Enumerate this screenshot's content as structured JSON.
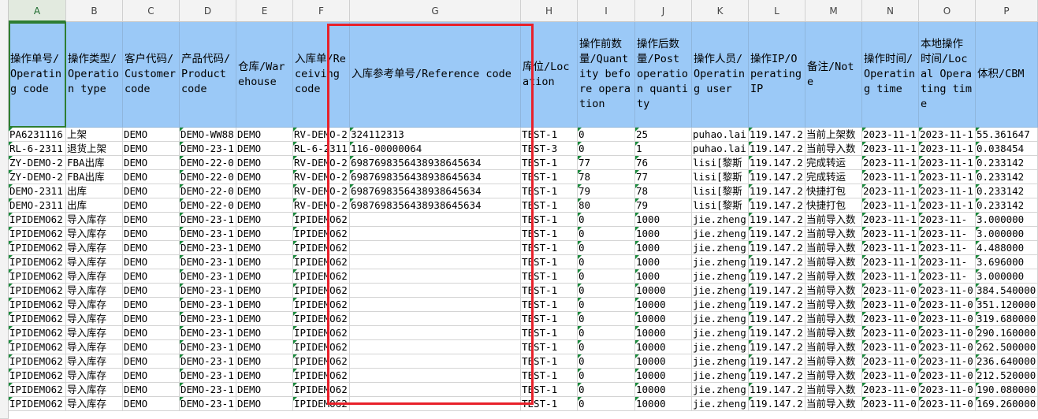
{
  "columns": [
    {
      "letter": "A",
      "header": "操作单号/Operating code"
    },
    {
      "letter": "B",
      "header": "操作类型/Operation type"
    },
    {
      "letter": "C",
      "header": "客户代码/Customer code"
    },
    {
      "letter": "D",
      "header": "产品代码/Product code"
    },
    {
      "letter": "E",
      "header": "仓库/Warehouse"
    },
    {
      "letter": "F",
      "header": "入库单/Receiving code"
    },
    {
      "letter": "G",
      "header": "入库参考单号/Reference code"
    },
    {
      "letter": "H",
      "header": "库位/Location"
    },
    {
      "letter": "I",
      "header": "操作前数量/Quantity before operation"
    },
    {
      "letter": "J",
      "header": "操作后数量/Post operation quantity"
    },
    {
      "letter": "K",
      "header": "操作人员/Operating user"
    },
    {
      "letter": "L",
      "header": "操作IP/Operating IP"
    },
    {
      "letter": "M",
      "header": "备注/Note"
    },
    {
      "letter": "N",
      "header": "操作时间/Operating time"
    },
    {
      "letter": "O",
      "header": "本地操作时间/Local Operating time"
    },
    {
      "letter": "P",
      "header": "体积/CBM"
    }
  ],
  "rows": [
    [
      "PA6231116",
      "上架",
      "DEMO",
      "DEMO-WW88",
      "DEMO",
      "RV-DEMO-2",
      "324112313",
      "TEST-1",
      "0",
      "25",
      "puhao.lai",
      "119.147.2",
      "当前上架数",
      "2023-11-1",
      "2023-11-1",
      "55.361647"
    ],
    [
      "RL-6-2311",
      "退货上架",
      "DEMO",
      "DEMO-23-1",
      "DEMO",
      "RL-6-2311",
      "116-00000064",
      "TEST-3",
      "0",
      "1",
      "puhao.lai",
      "119.147.2",
      "当前导入数",
      "2023-11-1",
      "2023-11-1",
      "0.038454"
    ],
    [
      "ZY-DEMO-2",
      "FBA出库",
      "DEMO",
      "DEMO-22-0",
      "DEMO",
      "RV-DEMO-2",
      "6987698356438938645634",
      "TEST-1",
      "77",
      "76",
      "lisi[黎斯",
      "119.147.2",
      "完成转运",
      "2023-11-1",
      "2023-11-1",
      "0.233142"
    ],
    [
      "ZY-DEMO-2",
      "FBA出库",
      "DEMO",
      "DEMO-22-0",
      "DEMO",
      "RV-DEMO-2",
      "6987698356438938645634",
      "TEST-1",
      "78",
      "77",
      "lisi[黎斯",
      "119.147.2",
      "完成转运",
      "2023-11-1",
      "2023-11-1",
      "0.233142"
    ],
    [
      "DEMO-2311",
      "出库",
      "DEMO",
      "DEMO-22-0",
      "DEMO",
      "RV-DEMO-2",
      "6987698356438938645634",
      "TEST-1",
      "79",
      "78",
      "lisi[黎斯",
      "119.147.2",
      "快捷打包",
      "2023-11-1",
      "2023-11-1",
      "0.233142"
    ],
    [
      "DEMO-2311",
      "出库",
      "DEMO",
      "DEMO-22-0",
      "DEMO",
      "RV-DEMO-2",
      "6987698356438938645634",
      "TEST-1",
      "80",
      "79",
      "lisi[黎斯",
      "119.147.2",
      "快捷打包",
      "2023-11-1",
      "2023-11-1",
      "0.233142"
    ],
    [
      "IPIDEMO62",
      "导入库存",
      "DEMO",
      "DEMO-23-1",
      "DEMO",
      "IPIDEMO62",
      "",
      "TEST-1",
      "0",
      "1000",
      "jie.zheng",
      "119.147.2",
      "当前导入数",
      "2023-11-1",
      "2023-11-",
      "3.000000"
    ],
    [
      "IPIDEMO62",
      "导入库存",
      "DEMO",
      "DEMO-23-1",
      "DEMO",
      "IPIDEMO62",
      "",
      "TEST-1",
      "0",
      "1000",
      "jie.zheng",
      "119.147.2",
      "当前导入数",
      "2023-11-1",
      "2023-11-",
      "3.000000"
    ],
    [
      "IPIDEMO62",
      "导入库存",
      "DEMO",
      "DEMO-23-1",
      "DEMO",
      "IPIDEMO62",
      "",
      "TEST-1",
      "0",
      "1000",
      "jie.zheng",
      "119.147.2",
      "当前导入数",
      "2023-11-1",
      "2023-11-",
      "4.488000"
    ],
    [
      "IPIDEMO62",
      "导入库存",
      "DEMO",
      "DEMO-23-1",
      "DEMO",
      "IPIDEMO62",
      "",
      "TEST-1",
      "0",
      "1000",
      "jie.zheng",
      "119.147.2",
      "当前导入数",
      "2023-11-1",
      "2023-11-",
      "3.696000"
    ],
    [
      "IPIDEMO62",
      "导入库存",
      "DEMO",
      "DEMO-23-1",
      "DEMO",
      "IPIDEMO62",
      "",
      "TEST-1",
      "0",
      "1000",
      "jie.zheng",
      "119.147.2",
      "当前导入数",
      "2023-11-1",
      "2023-11-",
      "3.000000"
    ],
    [
      "IPIDEMO62",
      "导入库存",
      "DEMO",
      "DEMO-23-1",
      "DEMO",
      "IPIDEMO62",
      "",
      "TEST-1",
      "0",
      "10000",
      "jie.zheng",
      "119.147.2",
      "当前导入数",
      "2023-11-0",
      "2023-11-0",
      "384.540000"
    ],
    [
      "IPIDEMO62",
      "导入库存",
      "DEMO",
      "DEMO-23-1",
      "DEMO",
      "IPIDEMO62",
      "",
      "TEST-1",
      "0",
      "10000",
      "jie.zheng",
      "119.147.2",
      "当前导入数",
      "2023-11-0",
      "2023-11-0",
      "351.120000"
    ],
    [
      "IPIDEMO62",
      "导入库存",
      "DEMO",
      "DEMO-23-1",
      "DEMO",
      "IPIDEMO62",
      "",
      "TEST-1",
      "0",
      "10000",
      "jie.zheng",
      "119.147.2",
      "当前导入数",
      "2023-11-0",
      "2023-11-0",
      "319.680000"
    ],
    [
      "IPIDEMO62",
      "导入库存",
      "DEMO",
      "DEMO-23-1",
      "DEMO",
      "IPIDEMO62",
      "",
      "TEST-1",
      "0",
      "10000",
      "jie.zheng",
      "119.147.2",
      "当前导入数",
      "2023-11-0",
      "2023-11-0",
      "290.160000"
    ],
    [
      "IPIDEMO62",
      "导入库存",
      "DEMO",
      "DEMO-23-1",
      "DEMO",
      "IPIDEMO62",
      "",
      "TEST-1",
      "0",
      "10000",
      "jie.zheng",
      "119.147.2",
      "当前导入数",
      "2023-11-0",
      "2023-11-0",
      "262.500000"
    ],
    [
      "IPIDEMO62",
      "导入库存",
      "DEMO",
      "DEMO-23-1",
      "DEMO",
      "IPIDEMO62",
      "",
      "TEST-1",
      "0",
      "10000",
      "jie.zheng",
      "119.147.2",
      "当前导入数",
      "2023-11-0",
      "2023-11-0",
      "236.640000"
    ],
    [
      "IPIDEMO62",
      "导入库存",
      "DEMO",
      "DEMO-23-1",
      "DEMO",
      "IPIDEMO62",
      "",
      "TEST-1",
      "0",
      "10000",
      "jie.zheng",
      "119.147.2",
      "当前导入数",
      "2023-11-0",
      "2023-11-0",
      "212.520000"
    ],
    [
      "IPIDEMO62",
      "导入库存",
      "DEMO",
      "DEMO-23-1",
      "DEMO",
      "IPIDEMO62",
      "",
      "TEST-1",
      "0",
      "10000",
      "jie.zheng",
      "119.147.2",
      "当前导入数",
      "2023-11-0",
      "2023-11-0",
      "190.080000"
    ],
    [
      "IPIDEMO62",
      "导入库存",
      "DEMO",
      "DEMO-23-1",
      "DEMO",
      "IPIDEMO62",
      "",
      "TEST-1",
      "0",
      "10000",
      "jie.zheng",
      "119.147.2",
      "当前导入数",
      "2023-11-0",
      "2023-11-0",
      "169.260000"
    ]
  ],
  "colors": {
    "header_fill": "#9bc9f7",
    "selection_border": "#2e7d32",
    "highlight_box": "#e8202a",
    "error_triangle": "#1a8a3c"
  }
}
